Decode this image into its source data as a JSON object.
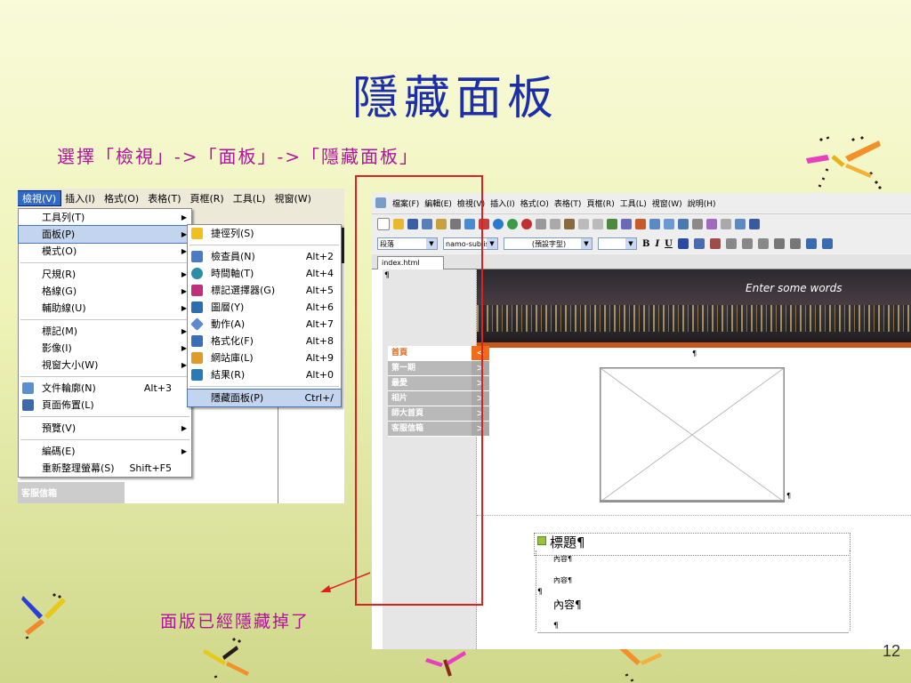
{
  "slide": {
    "title": "隱藏面板",
    "subtitle": "選擇「檢視」->「面板」->「隱藏面板」",
    "caption": "面版已經隱藏掉了",
    "page_number": "12"
  },
  "left_screenshot": {
    "menubar": [
      "檢視(V)",
      "插入(I)",
      "格式(O)",
      "表格(T)",
      "頁框(R)",
      "工具(L)",
      "視窗(W)"
    ],
    "view_menu": [
      {
        "label": "工具列(T)",
        "submenu": true
      },
      {
        "label": "面板(P)",
        "submenu": true,
        "selected": true
      },
      {
        "label": "模式(O)",
        "submenu": true
      },
      {
        "sep": true
      },
      {
        "label": "尺規(R)",
        "submenu": true
      },
      {
        "label": "格線(G)",
        "submenu": true
      },
      {
        "label": "輔助線(U)",
        "submenu": true
      },
      {
        "sep": true
      },
      {
        "label": "標記(M)",
        "submenu": true
      },
      {
        "label": "影像(I)",
        "submenu": true
      },
      {
        "label": "視窗大小(W)",
        "submenu": true
      },
      {
        "sep": true
      },
      {
        "label": "文件輪廓(N)",
        "shortcut": "Alt+3",
        "icon": "document-outline-icon"
      },
      {
        "label": "頁面佈置(L)",
        "icon": "page-layout-icon"
      },
      {
        "sep": true
      },
      {
        "label": "預覽(V)",
        "submenu": true
      },
      {
        "sep": true
      },
      {
        "label": "編碼(E)",
        "submenu": true
      },
      {
        "label": "重新整理螢幕(S)",
        "shortcut": "Shift+F5"
      }
    ],
    "panel_menu": [
      {
        "label": "捷徑列(S)",
        "icon": "shortcut-bar-icon"
      },
      {
        "sep": true
      },
      {
        "label": "檢查員(N)",
        "shortcut": "Alt+2",
        "icon": "inspector-icon"
      },
      {
        "label": "時間軸(T)",
        "shortcut": "Alt+4",
        "icon": "timeline-icon"
      },
      {
        "label": "標記選擇器(G)",
        "shortcut": "Alt+5",
        "icon": "tag-selector-icon"
      },
      {
        "label": "圖層(Y)",
        "shortcut": "Alt+6",
        "icon": "layers-icon"
      },
      {
        "label": "動作(A)",
        "shortcut": "Alt+7",
        "icon": "actions-icon"
      },
      {
        "label": "格式化(F)",
        "shortcut": "Alt+8",
        "icon": "formatting-icon"
      },
      {
        "label": "網站庫(L)",
        "shortcut": "Alt+9",
        "icon": "site-library-icon"
      },
      {
        "label": "結果(R)",
        "shortcut": "Alt+0",
        "icon": "results-icon"
      },
      {
        "sep": true
      },
      {
        "label": "隱藏面板(P)",
        "shortcut": "Ctrl+/",
        "selected": true
      }
    ],
    "bg_sidebar_text": "客服信箱"
  },
  "right_screenshot": {
    "menubar": [
      "檔案(F)",
      "編輯(E)",
      "檢視(V)",
      "插入(I)",
      "格式(O)",
      "表格(T)",
      "頁框(R)",
      "工具(L)",
      "視窗(W)",
      "說明(H)"
    ],
    "format_bar": {
      "paragraph": "段落",
      "font": "namo-sublist",
      "font_face": "(預設字型)",
      "size": "",
      "buttons": [
        "B",
        "I",
        "U"
      ]
    },
    "tab": "index.html",
    "banner_text": "Enter some words",
    "nav_items": [
      "首頁",
      "第一期",
      "最愛",
      "相片",
      "師大首頁",
      "客服信箱"
    ],
    "heading": "標題¶",
    "content_small_1": "內容¶",
    "content_small_2": "內容¶",
    "content_body": "內容¶",
    "para_marks": [
      "¶",
      "¶",
      "¶",
      "¶",
      "¶"
    ]
  },
  "colors": {
    "title": "#1c2fa8",
    "accent_text": "#b0139a",
    "annotation_red": "#e02020",
    "nav_active": "#f06b1a"
  }
}
